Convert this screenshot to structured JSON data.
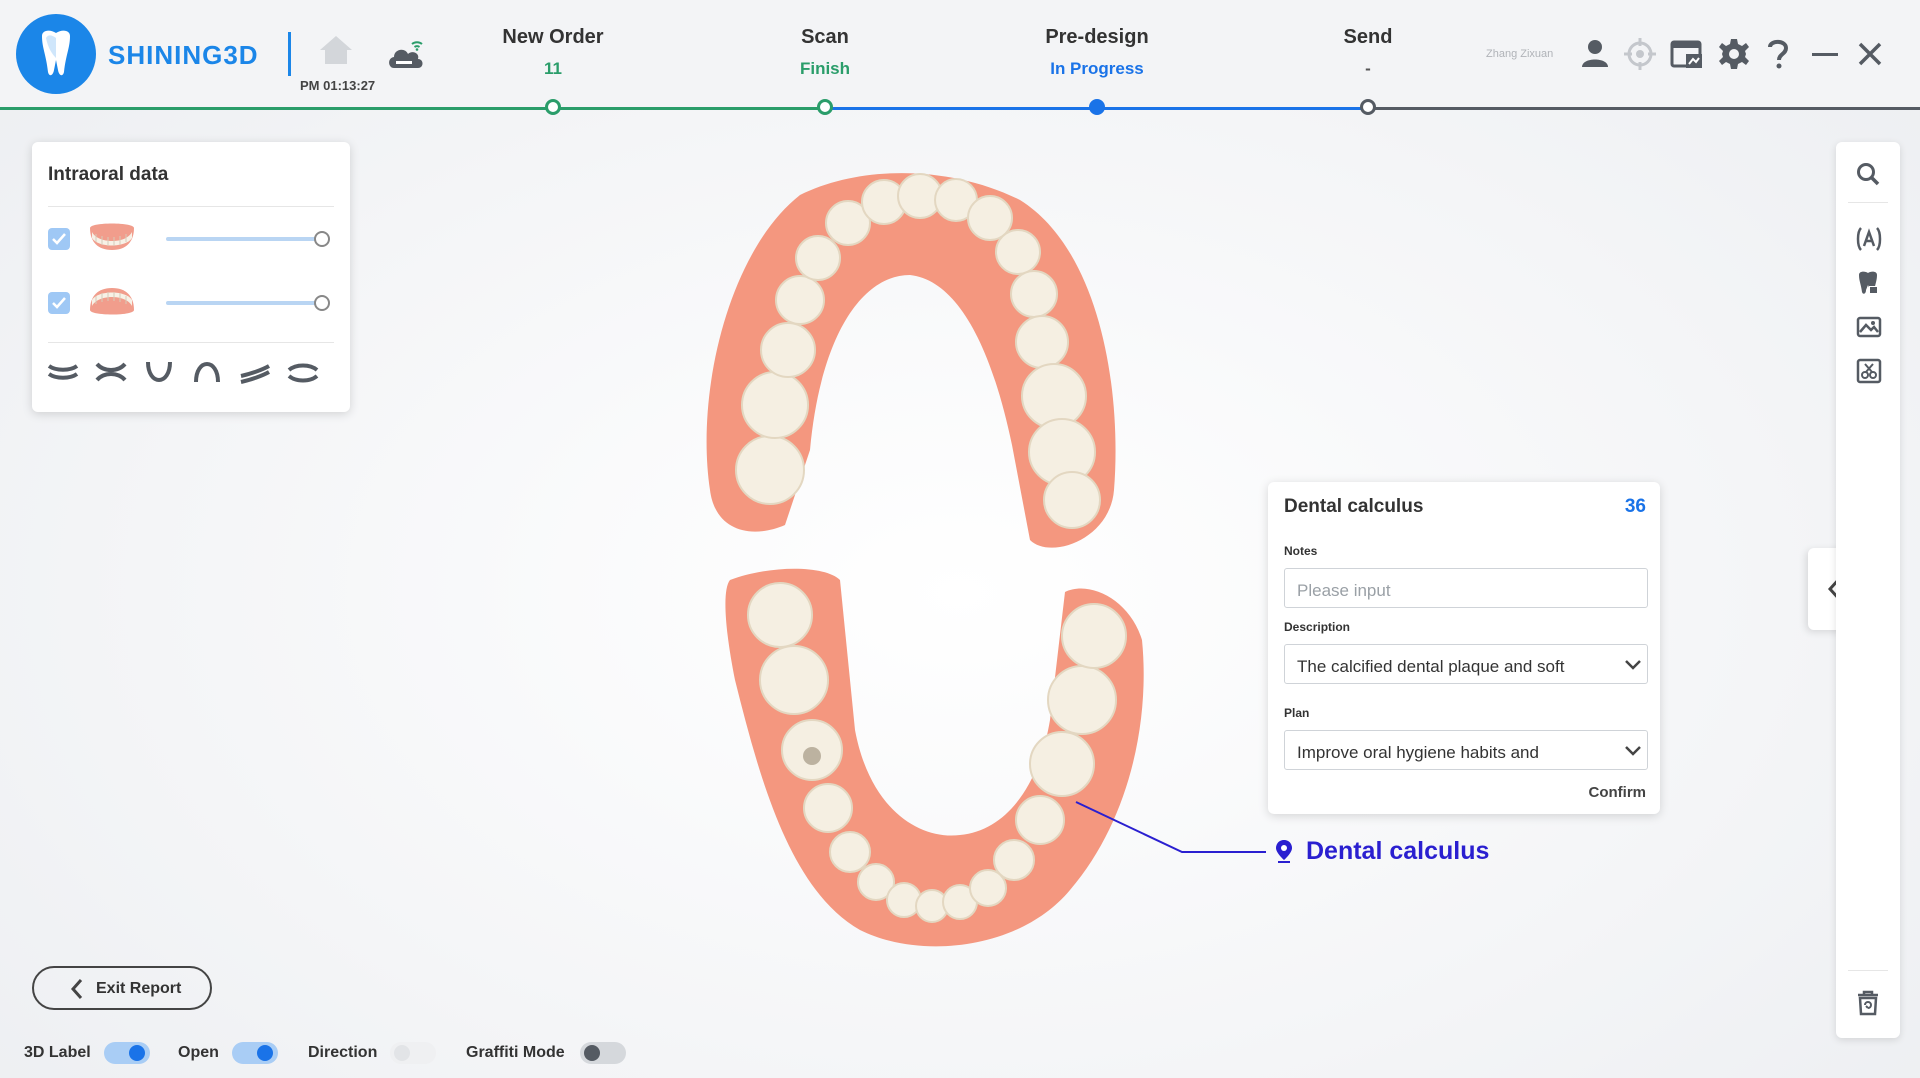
{
  "header": {
    "brand": "SHINING3D",
    "clock": "PM 01:13:27",
    "user_name": "Zhang Zixuan",
    "steps": [
      {
        "title": "New Order",
        "status": "11",
        "status_color": "#2a9d6a"
      },
      {
        "title": "Scan",
        "status": "Finish",
        "status_color": "#2a9d6a"
      },
      {
        "title": "Pre-design",
        "status": "In Progress",
        "status_color": "#1a73e8"
      },
      {
        "title": "Send",
        "status": "-",
        "status_color": "#555555"
      }
    ],
    "icons": [
      "home-icon",
      "cloud-wifi-icon",
      "user-icon",
      "target-icon",
      "screenshot-window-icon",
      "gear-icon",
      "help-icon",
      "minimize-icon",
      "close-icon"
    ]
  },
  "intraoral": {
    "title": "Intraoral data",
    "layers": [
      {
        "name": "upper-jaw",
        "checked": true,
        "opacity": 1.0
      },
      {
        "name": "lower-jaw",
        "checked": true,
        "opacity": 1.0
      }
    ],
    "view_icons": [
      "view-front-icon",
      "view-open-icon",
      "view-lower-icon",
      "view-upper-icon",
      "view-left-icon",
      "view-right-icon"
    ]
  },
  "calculus_panel": {
    "title": "Dental calculus",
    "tooth_number": "36",
    "notes_label": "Notes",
    "notes_placeholder": "Please input",
    "description_label": "Description",
    "description_value": "The calcified dental plaque and soft",
    "plan_label": "Plan",
    "plan_value": "Improve oral hygiene habits and",
    "confirm_label": "Confirm"
  },
  "annotation": {
    "label": "Dental calculus",
    "color": "#2a1fd0"
  },
  "right_toolbar": {
    "icons": [
      "magnifier-icon",
      "text-label-icon",
      "tooth-icon",
      "image-gallery-icon",
      "cut-icon",
      "delete-icon"
    ]
  },
  "bottom": {
    "exit_label": "Exit Report",
    "toggles": [
      {
        "label": "3D Label",
        "on": true
      },
      {
        "label": "Open",
        "on": true
      },
      {
        "label": "Direction",
        "on": false,
        "disabled": true
      },
      {
        "label": "Graffiti Mode",
        "on": false
      }
    ]
  },
  "colors": {
    "accent": "#1b86e8",
    "progress_green": "#2a9d6a",
    "progress_blue": "#1a73e8"
  }
}
